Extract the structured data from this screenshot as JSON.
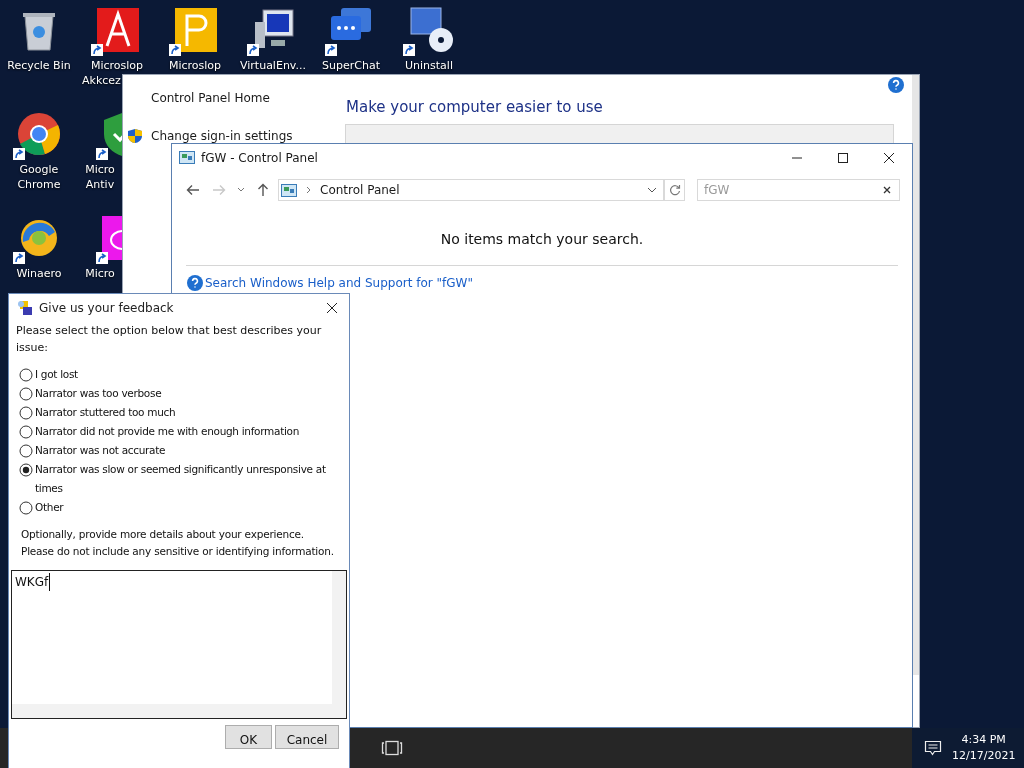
{
  "desktop_icons": [
    {
      "kind": "recycle",
      "lines": [
        "Recycle Bin"
      ],
      "shortcut": false
    },
    {
      "kind": "red-a",
      "lines": [
        "Microslop",
        "Akkcez"
      ],
      "shortcut": true
    },
    {
      "kind": "yellow-p",
      "lines": [
        "Microslop"
      ],
      "shortcut": true
    },
    {
      "kind": "computer",
      "lines": [
        "VirtualEnv..."
      ],
      "shortcut": true
    },
    {
      "kind": "chat",
      "lines": [
        "SuperChat"
      ],
      "shortcut": true
    },
    {
      "kind": "uninstall",
      "lines": [
        "Uninstall"
      ],
      "shortcut": true
    },
    {
      "kind": "chrome",
      "lines": [
        "Google",
        "Chrome"
      ],
      "shortcut": true
    },
    {
      "kind": "shield",
      "lines": [
        "Micro",
        "Antiv"
      ],
      "shortcut": true
    },
    {
      "kind": "winaero",
      "lines": [
        "Winaero"
      ],
      "shortcut": true
    },
    {
      "kind": "magenta",
      "lines": [
        "Micro"
      ],
      "shortcut": true
    }
  ],
  "back_window": {
    "links": [
      "Control Panel Home",
      "Change sign-in settings"
    ],
    "heading": "Make your computer easier to use"
  },
  "explorer": {
    "title": "fGW - Control Panel",
    "path": "Control Panel",
    "search": "fGW",
    "message": "No items match your search.",
    "help_link": "Search Windows Help and Support for \"fGW\""
  },
  "feedback": {
    "title": "Give us your feedback",
    "prompt": "Please select the option below that best describes your issue:",
    "options": [
      {
        "label": "I got lost",
        "selected": false
      },
      {
        "label": "Narrator was too verbose",
        "selected": false
      },
      {
        "label": "Narrator stuttered too much",
        "selected": false
      },
      {
        "label": "Narrator did not provide me with enough information",
        "selected": false
      },
      {
        "label": "Narrator was not accurate",
        "selected": false
      },
      {
        "label": "Narrator was slow or seemed significantly unresponsive at times",
        "selected": true
      },
      {
        "label": "Other",
        "selected": false
      }
    ],
    "details": "Optionally, provide more details about your experience. Please do not include any sensitive or identifying information.",
    "value": "WKGf",
    "buttons": [
      "OK",
      "Cancel"
    ]
  },
  "taskbar": {
    "time": "4:34 PM",
    "date": "12/17/2021"
  }
}
